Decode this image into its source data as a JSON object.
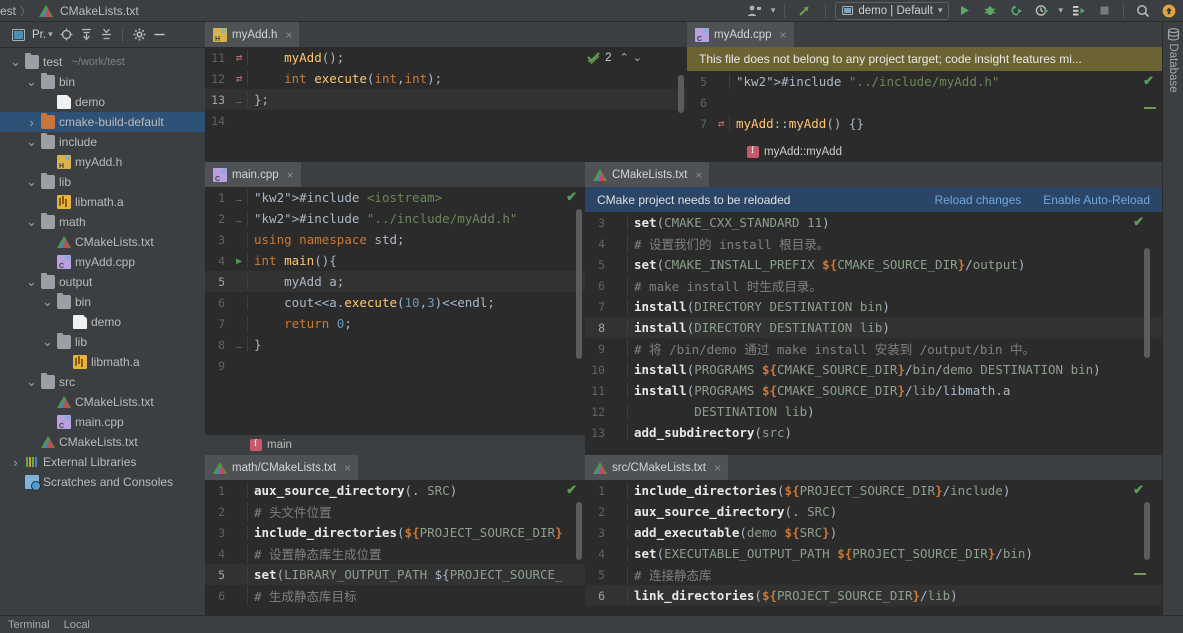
{
  "window": {
    "breadcrumb": {
      "project": "est",
      "separator": "〉",
      "file": "CMakeLists.txt"
    }
  },
  "toolbar": {
    "vcs_icon": "user-settings-icon",
    "updates_icon": "arrow-up-icon",
    "run_config": {
      "label": "demo | Default",
      "icon": "run-config-icon",
      "chevron": "▾"
    },
    "buttons": [
      {
        "name": "run-button",
        "glyph": "▶",
        "color": "#59a869"
      },
      {
        "name": "debug-button",
        "glyph": "bug",
        "color": "#59a869"
      },
      {
        "name": "run-with-coverage-button",
        "glyph": "coverage",
        "color": "#59a869"
      },
      {
        "name": "profile-button",
        "glyph": "profile",
        "color": "#59a869"
      },
      {
        "name": "attach-to-process-button",
        "glyph": "attach",
        "color": "#59a869"
      },
      {
        "name": "stop-button",
        "glyph": "■",
        "color": "#7a7a7a"
      }
    ],
    "search_icon": "search-icon",
    "notification_badge": "update-badge-icon"
  },
  "project_panel": {
    "title": "Pr.",
    "title_chevron": "▾",
    "header_icons": [
      "project-view-icon",
      "locate-icon",
      "expand-all-icon",
      "collapse-all-icon",
      "settings-gear-icon",
      "hide-panel-icon"
    ],
    "tree": [
      {
        "depth": 0,
        "twist": "⌄",
        "icon": "folder",
        "label": "test",
        "path": "~/work/test",
        "selected": false
      },
      {
        "depth": 1,
        "twist": "⌄",
        "icon": "folder",
        "label": "bin",
        "path": "",
        "selected": false
      },
      {
        "depth": 2,
        "twist": "",
        "icon": "file",
        "label": "demo",
        "path": "",
        "selected": false
      },
      {
        "depth": 1,
        "twist": "›",
        "icon": "folder-orange",
        "label": "cmake-build-default",
        "path": "",
        "selected": true
      },
      {
        "depth": 1,
        "twist": "⌄",
        "icon": "folder",
        "label": "include",
        "path": "",
        "selected": false
      },
      {
        "depth": 2,
        "twist": "",
        "icon": "header",
        "label": "myAdd.h",
        "path": "",
        "selected": false
      },
      {
        "depth": 1,
        "twist": "⌄",
        "icon": "folder",
        "label": "lib",
        "path": "",
        "selected": false
      },
      {
        "depth": 2,
        "twist": "",
        "icon": "archive",
        "label": "libmath.a",
        "path": "",
        "selected": false
      },
      {
        "depth": 1,
        "twist": "⌄",
        "icon": "folder",
        "label": "math",
        "path": "",
        "selected": false
      },
      {
        "depth": 2,
        "twist": "",
        "icon": "cmake",
        "label": "CMakeLists.txt",
        "path": "",
        "selected": false
      },
      {
        "depth": 2,
        "twist": "",
        "icon": "cpp",
        "label": "myAdd.cpp",
        "path": "",
        "selected": false
      },
      {
        "depth": 1,
        "twist": "⌄",
        "icon": "folder",
        "label": "output",
        "path": "",
        "selected": false
      },
      {
        "depth": 2,
        "twist": "⌄",
        "icon": "folder",
        "label": "bin",
        "path": "",
        "selected": false
      },
      {
        "depth": 3,
        "twist": "",
        "icon": "file",
        "label": "demo",
        "path": "",
        "selected": false
      },
      {
        "depth": 2,
        "twist": "⌄",
        "icon": "folder",
        "label": "lib",
        "path": "",
        "selected": false
      },
      {
        "depth": 3,
        "twist": "",
        "icon": "archive",
        "label": "libmath.a",
        "path": "",
        "selected": false
      },
      {
        "depth": 1,
        "twist": "⌄",
        "icon": "folder",
        "label": "src",
        "path": "",
        "selected": false
      },
      {
        "depth": 2,
        "twist": "",
        "icon": "cmake",
        "label": "CMakeLists.txt",
        "path": "",
        "selected": false
      },
      {
        "depth": 2,
        "twist": "",
        "icon": "cpp",
        "label": "main.cpp",
        "path": "",
        "selected": false
      },
      {
        "depth": 1,
        "twist": "",
        "icon": "cmake",
        "label": "CMakeLists.txt",
        "path": "",
        "selected": false
      },
      {
        "depth": 0,
        "twist": "›",
        "icon": "libraries",
        "label": "External Libraries",
        "path": "",
        "selected": false
      },
      {
        "depth": 0,
        "twist": "",
        "icon": "scratch",
        "label": "Scratches and Consoles",
        "path": "",
        "selected": false
      }
    ]
  },
  "panes": {
    "myadd_h": {
      "tab": {
        "label": "myAdd.h",
        "icon": "header-file-icon",
        "close": "×"
      },
      "inspection": {
        "count": "2",
        "up": "⌃",
        "down": "⌄"
      },
      "lines": [
        {
          "num": "11",
          "mark": "override",
          "text": "    myAdd();"
        },
        {
          "num": "12",
          "mark": "override",
          "text": "    int execute(int,int);"
        },
        {
          "num": "13",
          "mark": "fold",
          "text": "};",
          "current": true
        },
        {
          "num": "14",
          "mark": "",
          "text": ""
        }
      ]
    },
    "myadd_cpp": {
      "tab": {
        "label": "myAdd.cpp",
        "icon": "cpp-file-icon",
        "close": "×"
      },
      "warning": "This file does not belong to any project target; code insight features mi...",
      "lines": [
        {
          "num": "5",
          "mark": "",
          "text": "#include \"../include/myAdd.h\""
        },
        {
          "num": "6",
          "mark": "",
          "text": ""
        },
        {
          "num": "7",
          "mark": "override",
          "text": "myAdd::myAdd() {}"
        }
      ],
      "breadcrumb": "myAdd::myAdd"
    },
    "main_cpp": {
      "tab": {
        "label": "main.cpp",
        "icon": "cpp-file-icon",
        "close": "×"
      },
      "lines": [
        {
          "num": "1",
          "mark": "fold",
          "text": "#include <iostream>"
        },
        {
          "num": "2",
          "mark": "fold",
          "text": "#include \"../include/myAdd.h\""
        },
        {
          "num": "3",
          "mark": "",
          "text": "using namespace std;"
        },
        {
          "num": "4",
          "mark": "run",
          "text": "int main(){"
        },
        {
          "num": "5",
          "mark": "",
          "text": "    myAdd a;",
          "current": true
        },
        {
          "num": "6",
          "mark": "",
          "text": "    cout<<a.execute(10,3)<<endl;"
        },
        {
          "num": "7",
          "mark": "",
          "text": "    return 0;"
        },
        {
          "num": "8",
          "mark": "fold",
          "text": "}"
        },
        {
          "num": "9",
          "mark": "",
          "text": ""
        }
      ],
      "breadcrumb": "main"
    },
    "root_cmake": {
      "tab": {
        "label": "CMakeLists.txt",
        "icon": "cmake-file-icon",
        "close": "×"
      },
      "notification": {
        "message": "CMake project needs to be reloaded",
        "reload_label": "Reload changes",
        "autoreload_label": "Enable Auto-Reload"
      },
      "lines": [
        {
          "num": "3",
          "text": "set(CMAKE_CXX_STANDARD 11)"
        },
        {
          "num": "4",
          "text": "# 设置我们的 install 根目录。"
        },
        {
          "num": "5",
          "text": "set(CMAKE_INSTALL_PREFIX ${CMAKE_SOURCE_DIR}/output)"
        },
        {
          "num": "6",
          "text": "# make install 时生成目录。"
        },
        {
          "num": "7",
          "text": "install(DIRECTORY DESTINATION bin)"
        },
        {
          "num": "8",
          "text": "install(DIRECTORY DESTINATION lib)",
          "current": true
        },
        {
          "num": "9",
          "text": "# 将 /bin/demo 通过 make install 安装到 /output/bin 中。"
        },
        {
          "num": "10",
          "text": "install(PROGRAMS ${CMAKE_SOURCE_DIR}/bin/demo DESTINATION bin)"
        },
        {
          "num": "11",
          "text": "install(PROGRAMS ${CMAKE_SOURCE_DIR}/lib/libmath.a"
        },
        {
          "num": "12",
          "text": "        DESTINATION lib)"
        },
        {
          "num": "13",
          "text": "add_subdirectory(src)"
        }
      ]
    },
    "math_cmake": {
      "tab": {
        "label": "math/CMakeLists.txt",
        "icon": "cmake-file-icon",
        "close": "×"
      },
      "lines": [
        {
          "num": "1",
          "text": "aux_source_directory(. SRC)"
        },
        {
          "num": "2",
          "text": "# 头文件位置"
        },
        {
          "num": "3",
          "text": "include_directories(${PROJECT_SOURCE_DIR}"
        },
        {
          "num": "4",
          "text": "# 设置静态库生成位置"
        },
        {
          "num": "5",
          "text": "set(LIBRARY_OUTPUT_PATH ${PROJECT_SOURCE_",
          "current": true
        },
        {
          "num": "6",
          "text": "# 生成静态库目标"
        }
      ]
    },
    "src_cmake": {
      "tab": {
        "label": "src/CMakeLists.txt",
        "icon": "cmake-file-icon",
        "close": "×"
      },
      "lines": [
        {
          "num": "1",
          "text": "include_directories(${PROJECT_SOURCE_DIR}/include)"
        },
        {
          "num": "2",
          "text": "aux_source_directory(. SRC)"
        },
        {
          "num": "3",
          "text": "add_executable(demo ${SRC})"
        },
        {
          "num": "4",
          "text": "set(EXECUTABLE_OUTPUT_PATH ${PROJECT_SOURCE_DIR}/bin)"
        },
        {
          "num": "5",
          "text": "# 连接静态库"
        },
        {
          "num": "6",
          "text": "link_directories(${PROJECT_SOURCE_DIR}/lib)",
          "current": true
        }
      ]
    }
  },
  "right_tool_window": {
    "label": "Database",
    "icon": "database-icon"
  },
  "status_bar": {
    "terminal": "Terminal",
    "local": "Local"
  },
  "colors": {
    "accent_blue": "#2d5177",
    "notification_bg": "#2b4566",
    "warning_bg": "#6b6432",
    "link": "#6fa8dc",
    "editor_bg": "#2b2b2b",
    "panel_bg": "#3c3f41",
    "ok_green": "#5a9e5a"
  }
}
